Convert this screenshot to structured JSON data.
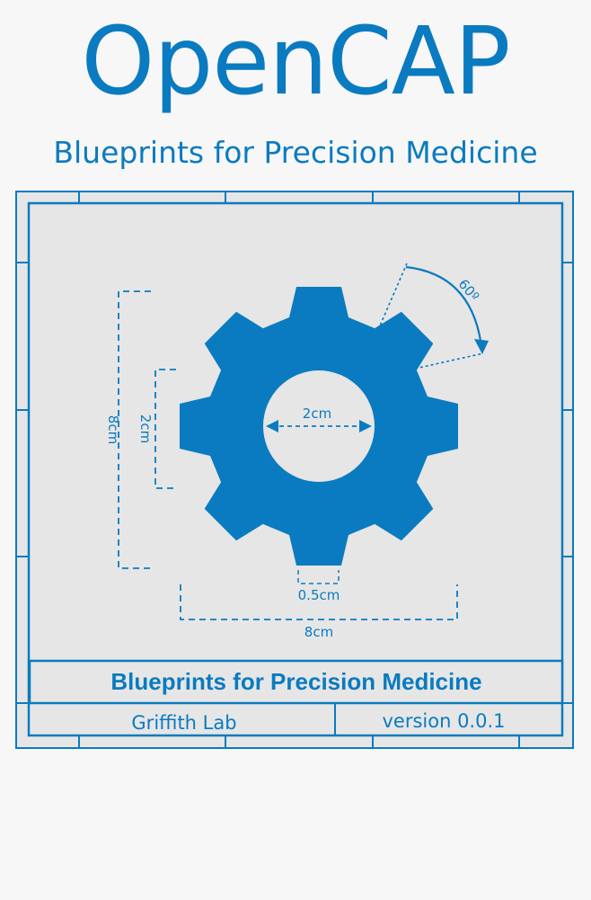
{
  "header": {
    "title": "OpenCAP",
    "subtitle": "Blueprints for Precision Medicine"
  },
  "diagram": {
    "angle_label": "60º",
    "hole_label": "2cm",
    "inner_height_label": "2cm",
    "outer_height_label": "8cm",
    "tooth_width_label": "0.5cm",
    "outer_width_label": "8cm"
  },
  "title_block": {
    "heading": "Blueprints for Precision Medicine",
    "author": "Griffith Lab",
    "version": "version 0.0.1"
  },
  "colors": {
    "primary": "#0a7bc0",
    "panel": "#e6e6e6",
    "background": "#f7f7f7"
  }
}
